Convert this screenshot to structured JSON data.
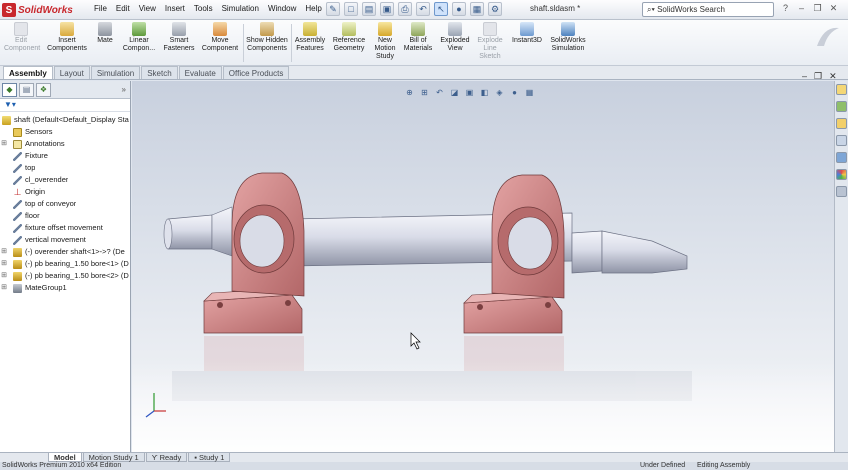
{
  "app": {
    "logo_text": "SolidWorks",
    "doc_title": "shaft.sldasm *"
  },
  "menu": [
    "File",
    "Edit",
    "View",
    "Insert",
    "Tools",
    "Simulation",
    "Window",
    "Help"
  ],
  "search": {
    "placeholder": "SolidWorks Search"
  },
  "toolbar": [
    {
      "label": "Edit Component",
      "icon": "edit-component-icon",
      "disabled": true
    },
    {
      "label": "Insert Components",
      "icon": "insert-components-icon"
    },
    {
      "label": "Mate",
      "icon": "mate-icon"
    },
    {
      "label": "Linear Compon...",
      "icon": "linear-pattern-icon"
    },
    {
      "label": "Smart Fasteners",
      "icon": "smart-fasteners-icon"
    },
    {
      "label": "Move Component",
      "icon": "move-component-icon"
    },
    {
      "label": "Show Hidden Components",
      "icon": "show-hidden-icon"
    },
    {
      "label": "Assembly Features",
      "icon": "assembly-features-icon"
    },
    {
      "label": "Reference Geometry",
      "icon": "reference-geometry-icon"
    },
    {
      "label": "New Motion Study",
      "icon": "motion-study-icon"
    },
    {
      "label": "Bill of Materials",
      "icon": "bom-icon"
    },
    {
      "label": "Exploded View",
      "icon": "exploded-view-icon"
    },
    {
      "label": "Explode Line Sketch",
      "icon": "explode-line-icon",
      "disabled": true
    },
    {
      "label": "Instant3D",
      "icon": "instant3d-icon"
    },
    {
      "label": "SolidWorks Simulation",
      "icon": "simulation-icon"
    }
  ],
  "tabs": [
    "Assembly",
    "Layout",
    "Simulation",
    "Sketch",
    "Evaluate",
    "Office Products"
  ],
  "feature_tree": {
    "root": "shaft  (Default<Default_Display Sta",
    "items": [
      "Sensors",
      "Annotations",
      "Fixture",
      "top",
      "cl_overender",
      "Origin",
      "top of conveyor",
      "floor",
      "fixture offset movement",
      "vertical movement",
      "(-) overender shaft<1>->? (De",
      "(-) pb bearing_1.50 bore<1> (D",
      "(-) pb bearing_1.50 bore<2> (D",
      "MateGroup1"
    ]
  },
  "bottom_tabs": [
    "Model",
    "Motion Study 1",
    "Ready",
    "Study 1"
  ],
  "status": {
    "left": "SolidWorks Premium 2010 x64 Edition",
    "state": "Under Defined",
    "mode": "Editing Assembly"
  },
  "colors": {
    "bearing": "#c97f80",
    "shaft": "#d7dbe8",
    "accent": "#c8282d"
  }
}
